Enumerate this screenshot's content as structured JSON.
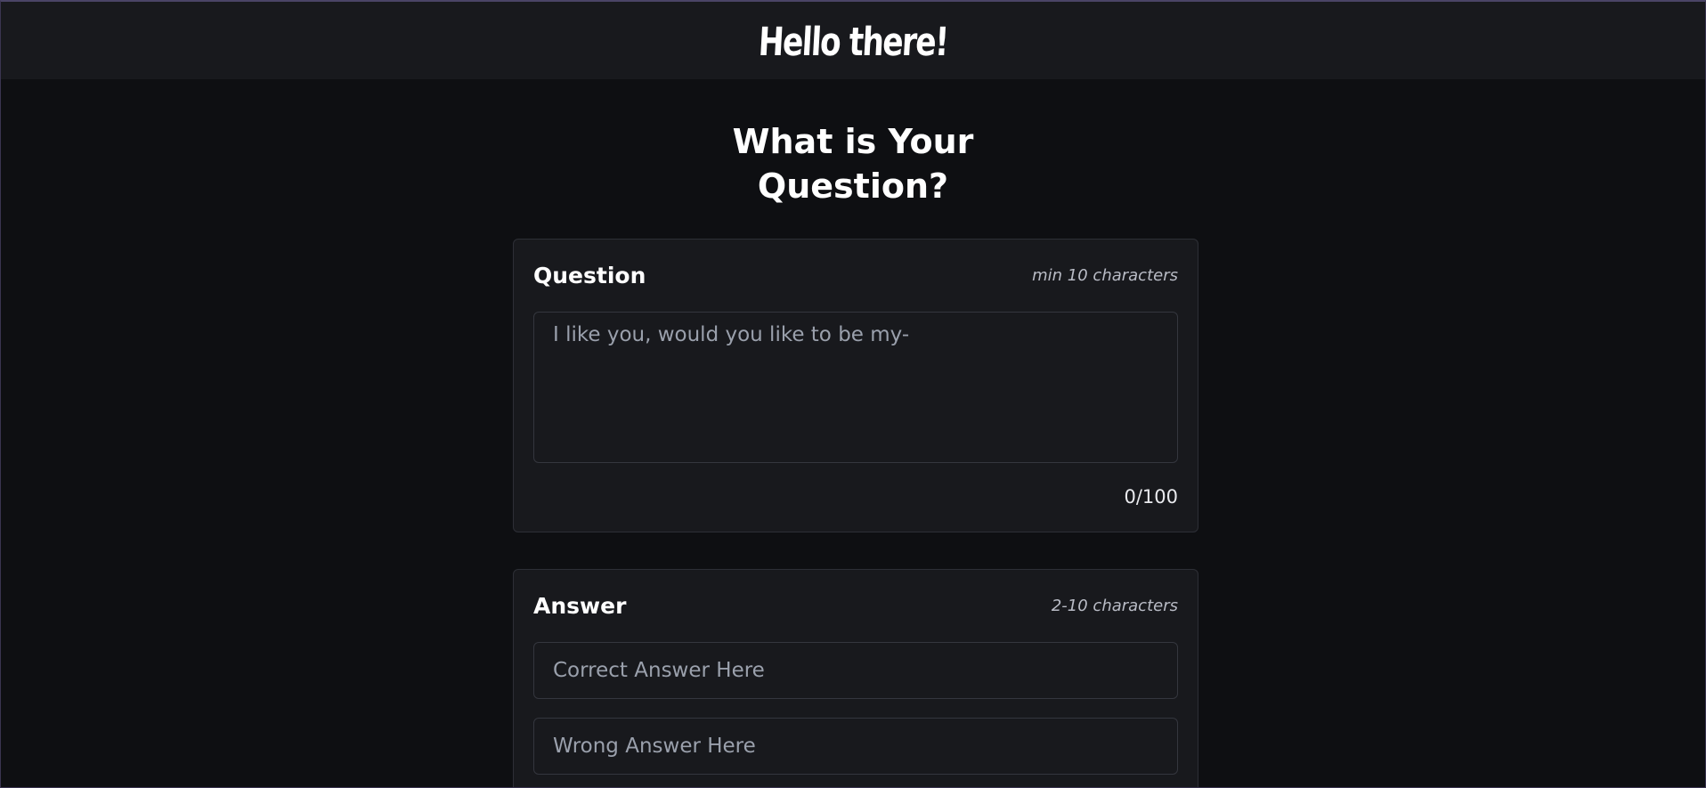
{
  "header": {
    "brand": "Hello there!"
  },
  "page": {
    "title_line1": "What is Your",
    "title_line2": "Question?"
  },
  "question_card": {
    "title": "Question",
    "hint": "min 10 characters",
    "placeholder": "I like you, would you like to be my-",
    "counter": "0/100"
  },
  "answer_card": {
    "title": "Answer",
    "hint": "2-10 characters",
    "correct_placeholder": "Correct Answer Here",
    "wrong_placeholder": "Wrong Answer Here"
  },
  "colors": {
    "background": "#0e0f12",
    "card": "#18191d",
    "border": "#2d2f36",
    "text": "#ffffff",
    "muted": "#9aa0ac"
  }
}
